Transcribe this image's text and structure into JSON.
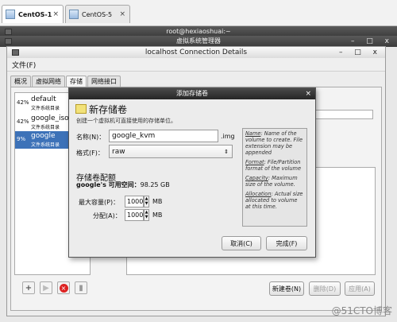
{
  "host_tabs": [
    {
      "label": "CentOS-1",
      "close": "×"
    },
    {
      "label": "CentOS-5",
      "close": "×"
    }
  ],
  "terminal_title": "root@hexiaoshuai:~",
  "vmm_title": "虚拟系统管理器",
  "window": {
    "title": "localhost Connection Details",
    "controls": "– □ x",
    "menu_file": "文件(F)",
    "tabs": [
      "概况",
      "虚拟网络",
      "存储",
      "网络接口"
    ]
  },
  "pools": [
    {
      "pct": "42%",
      "name": "default",
      "desc": "文件系统目录"
    },
    {
      "pct": "42%",
      "name": "google_iso",
      "desc": "文件系统目录"
    },
    {
      "pct": "9%",
      "name": "google",
      "desc": "文件系统目录"
    }
  ],
  "buttons": {
    "new_volume": "新建卷(N)",
    "delete_volume": "删除(D)",
    "apply": "应用(A)"
  },
  "dialog": {
    "title": "添加存储卷",
    "heading": "新存储卷",
    "subheading": "创建一个虚拟机可直接使用的存储单位。",
    "name_label": "名称(N)：",
    "name_value": "google_kvm",
    "name_suffix": ".img",
    "format_label": "格式(F)：",
    "format_value": "raw",
    "alloc_heading": "存储卷配额",
    "avail_label": "google's 可用空间：",
    "avail_value": "98.25 GB",
    "max_label": "最大容量(P)：",
    "max_value": "10000",
    "max_unit": "MB",
    "alloc_label": "分配(A)：",
    "alloc_value": "10000",
    "alloc_unit": "MB",
    "cancel": "取消(C)",
    "finish": "完成(F)",
    "help": {
      "name_key": "Name",
      "name_text": ": Name of the volume to create. File extension may be appended",
      "format_key": "Format",
      "format_text": ": File/Partition format of the volume",
      "capacity_key": "Capacity",
      "capacity_text": ": Maximum size of the volume.",
      "allocation_key": "Allocation",
      "allocation_text": ": Actual size allocated to volume at this time."
    }
  },
  "watermark": "@51CTO博客"
}
